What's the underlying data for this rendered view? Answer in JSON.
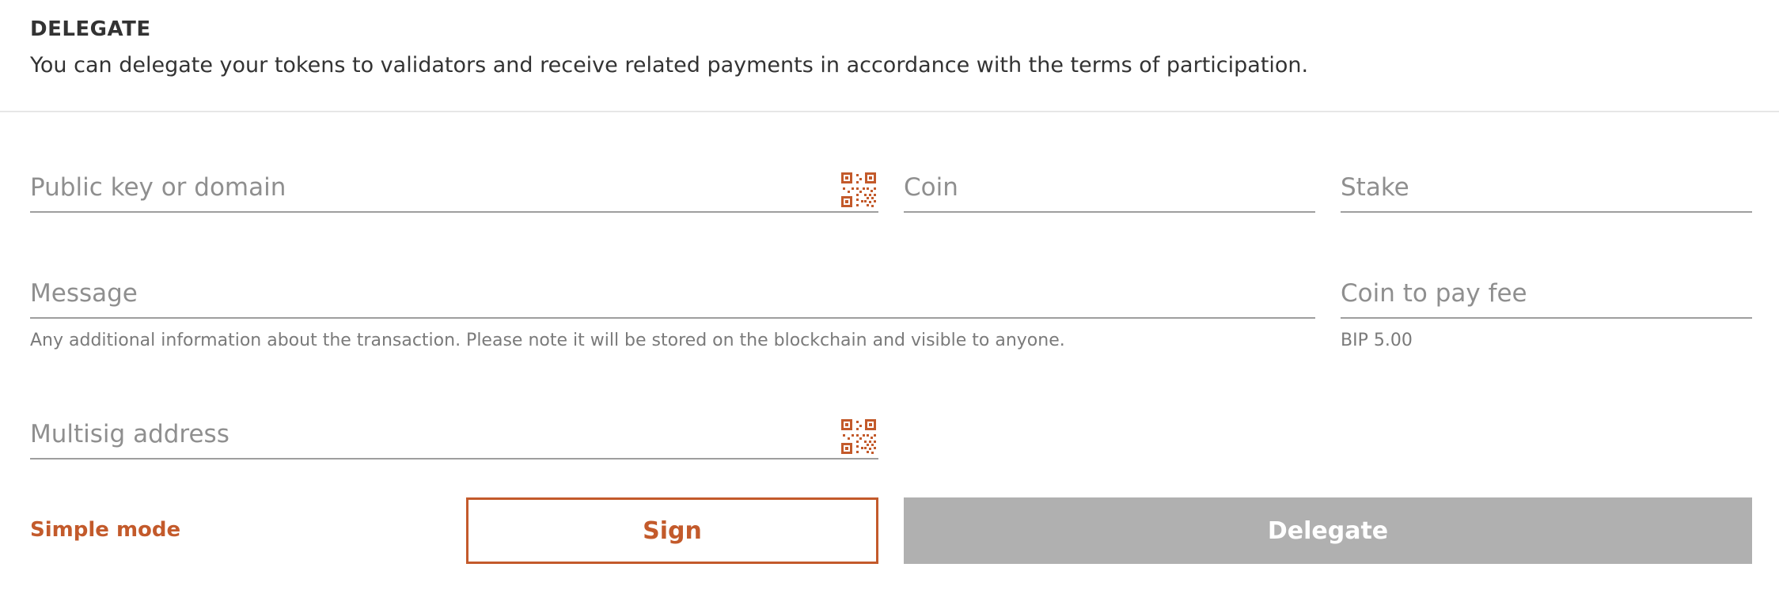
{
  "header": {
    "title": "DELEGATE",
    "description": "You can delegate your tokens to validators and receive related payments in accordance with the terms of participation."
  },
  "form": {
    "public_key": {
      "placeholder": "Public key or domain",
      "value": ""
    },
    "coin": {
      "placeholder": "Coin",
      "value": ""
    },
    "stake": {
      "placeholder": "Stake",
      "value": ""
    },
    "message": {
      "placeholder": "Message",
      "value": "",
      "hint": "Any additional information about the transaction. Please note it will be stored on the blockchain and visible to anyone."
    },
    "fee_coin": {
      "placeholder": "Coin to pay fee",
      "value": "",
      "hint": "BIP 5.00"
    },
    "multisig": {
      "placeholder": "Multisig address",
      "value": ""
    }
  },
  "actions": {
    "simple_mode_label": "Simple mode",
    "sign_label": "Sign",
    "delegate_label": "Delegate"
  },
  "icons": {
    "qr": "qr-code-scan-icon"
  },
  "colors": {
    "accent": "#c35a2b",
    "disabled_button": "#b0b0b0",
    "text": "#333333",
    "placeholder": "#8f8f8f",
    "hint": "#7a7a7a"
  }
}
